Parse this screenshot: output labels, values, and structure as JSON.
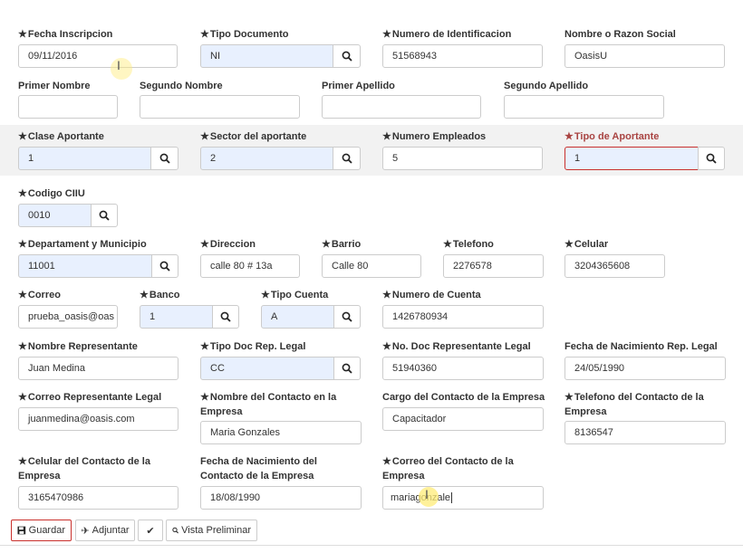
{
  "rows": {
    "r1": {
      "fecha_inscripcion": {
        "label": "Fecha Inscripcion",
        "value": "09/11/2016"
      },
      "tipo_documento": {
        "label": "Tipo Documento",
        "value": "NI"
      },
      "numero_identificacion": {
        "label": "Numero de Identificacion",
        "value": "51568943"
      },
      "nombre_razon_social": {
        "label": "Nombre o Razon Social",
        "value": "OasisU"
      }
    },
    "r2": {
      "primer_nombre": {
        "label": "Primer Nombre",
        "value": ""
      },
      "segundo_nombre": {
        "label": "Segundo Nombre",
        "value": ""
      },
      "primer_apellido": {
        "label": "Primer Apellido",
        "value": ""
      },
      "segundo_apellido": {
        "label": "Segundo Apellido",
        "value": ""
      }
    },
    "r3": {
      "clase_aportante": {
        "label": "Clase Aportante",
        "value": "1"
      },
      "sector_aportante": {
        "label": "Sector del aportante",
        "value": "2"
      },
      "numero_empleados": {
        "label": "Numero Empleados",
        "value": "5"
      },
      "tipo_aportante": {
        "label": "Tipo de Aportante",
        "value": "1"
      }
    },
    "r4": {
      "codigo_ciiu": {
        "label": "Codigo CIIU",
        "value": "0010"
      }
    },
    "r5": {
      "departamento_municipio": {
        "label": "Departament y Municipio",
        "value": "11001"
      },
      "direccion": {
        "label": "Direccion",
        "value": "calle 80 # 13a"
      },
      "barrio": {
        "label": "Barrio",
        "value": "Calle 80"
      },
      "telefono": {
        "label": "Telefono",
        "value": "2276578"
      },
      "celular": {
        "label": "Celular",
        "value": "3204365608"
      }
    },
    "r6": {
      "correo": {
        "label": "Correo",
        "value": "prueba_oasis@oas"
      },
      "banco": {
        "label": "Banco",
        "value": "1"
      },
      "tipo_cuenta": {
        "label": "Tipo Cuenta",
        "value": "A"
      },
      "numero_cuenta": {
        "label": "Numero de Cuenta",
        "value": "1426780934"
      }
    },
    "r7": {
      "nombre_representante": {
        "label": "Nombre Representante",
        "value": "Juan Medina"
      },
      "tipo_doc_rep_legal": {
        "label": "Tipo Doc Rep. Legal",
        "value": "CC"
      },
      "no_doc_representante": {
        "label": "No. Doc Representante Legal",
        "value": "51940360"
      },
      "fecha_nac_rep_legal": {
        "label": "Fecha de Nacimiento Rep. Legal",
        "value": "24/05/1990"
      }
    },
    "r8": {
      "correo_rep_legal": {
        "label": "Correo Representante Legal",
        "value": "juanmedina@oasis.com"
      },
      "nombre_contacto": {
        "label": "Nombre del Contacto en la Empresa",
        "value": "Maria Gonzales"
      },
      "cargo_contacto": {
        "label": "Cargo del Contacto de la Empresa",
        "value": "Capacitador"
      },
      "telefono_contacto": {
        "label": "Telefono del Contacto de la Empresa",
        "value": "8136547"
      }
    },
    "r9": {
      "celular_contacto": {
        "label": "Celular del Contacto de la Empresa",
        "value": "3165470986"
      },
      "fecha_nac_contacto": {
        "label": "Fecha de Nacimiento del Contacto de la Empresa",
        "value": "18/08/1990"
      },
      "correo_contacto": {
        "label": "Correo del Contacto de la Empresa",
        "value": "mariagonzale"
      }
    }
  },
  "toolbar": {
    "guardar": "Guardar",
    "adjuntar": "Adjuntar",
    "check": "✔",
    "vista_preliminar": "Vista Preliminar"
  },
  "colors": {
    "required_error": "#a94442",
    "lookup_bg": "#e8f0fe",
    "primary_border": "#c9302c"
  },
  "icons": {
    "lookup": "search-icon",
    "save": "floppy-disk-icon",
    "attach": "paperclip-icon",
    "check": "check-icon",
    "preview": "search-icon"
  }
}
